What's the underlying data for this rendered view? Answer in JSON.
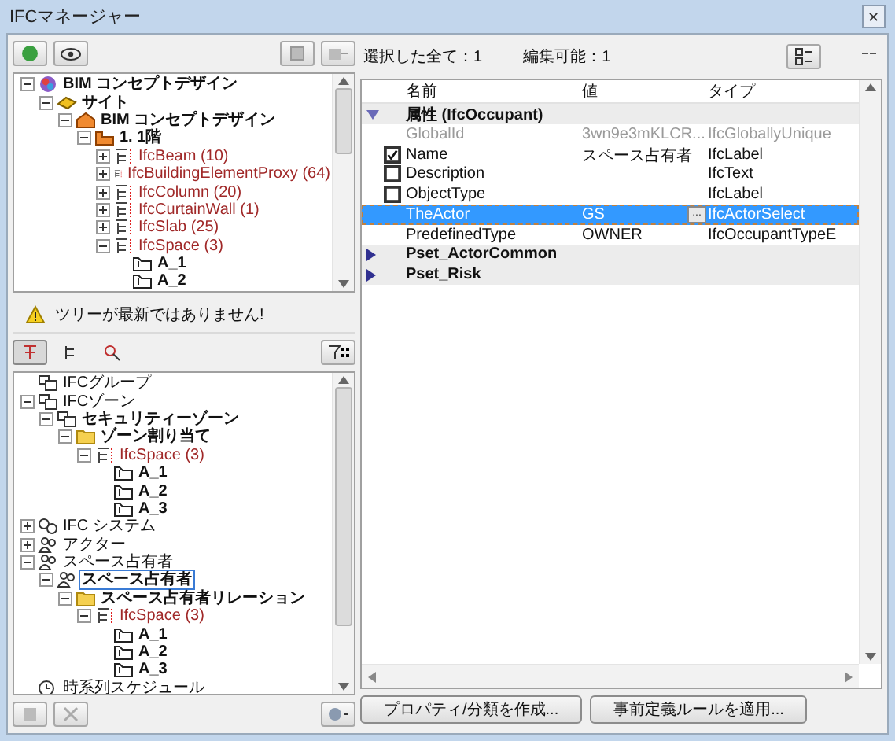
{
  "window": {
    "title": "IFCマネージャー",
    "close": "✕"
  },
  "tree_top": {
    "nodes": [
      {
        "label": "BIM コンセプトデザイン",
        "kind": "project",
        "bold": true,
        "expanded": true,
        "selected": false,
        "children": [
          {
            "label": "サイト",
            "kind": "site",
            "bold": true,
            "expanded": true,
            "selected": false,
            "children": [
              {
                "label": "BIM コンセプトデザイン",
                "kind": "building",
                "bold": true,
                "expanded": true,
                "selected": false,
                "children": [
                  {
                    "label": "1. 1階",
                    "kind": "storey",
                    "bold": true,
                    "expanded": true,
                    "selected": false,
                    "children": [
                      {
                        "label": "IfcBeam (10)",
                        "kind": "class",
                        "bold": false,
                        "expanded": false,
                        "selected": false
                      },
                      {
                        "label": "IfcBuildingElementProxy (64)",
                        "kind": "class",
                        "bold": false,
                        "expanded": false,
                        "selected": false
                      },
                      {
                        "label": "IfcColumn (20)",
                        "kind": "class",
                        "bold": false,
                        "expanded": false,
                        "selected": false
                      },
                      {
                        "label": "IfcCurtainWall (1)",
                        "kind": "class",
                        "bold": false,
                        "expanded": false,
                        "selected": false
                      },
                      {
                        "label": "IfcSlab (25)",
                        "kind": "class",
                        "bold": false,
                        "expanded": false,
                        "selected": false
                      },
                      {
                        "label": "IfcSpace (3)",
                        "kind": "class",
                        "bold": false,
                        "expanded": true,
                        "selected": false,
                        "children": [
                          {
                            "label": "A_1",
                            "kind": "space",
                            "bold": true,
                            "selected": false
                          },
                          {
                            "label": "A_2",
                            "kind": "space",
                            "bold": true,
                            "selected": false
                          }
                        ]
                      }
                    ]
                  }
                ]
              }
            ]
          }
        ]
      }
    ]
  },
  "warning": "ツリーが最新ではありません!",
  "tree_bottom": {
    "nodes": [
      {
        "label": "IFCグループ",
        "kind": "group",
        "bold": false,
        "selected": false
      },
      {
        "label": "IFCゾーン",
        "kind": "group",
        "bold": false,
        "expanded": true,
        "selected": false,
        "children": [
          {
            "label": "セキュリティーゾーン",
            "kind": "group",
            "bold": true,
            "expanded": true,
            "selected": false,
            "children": [
              {
                "label": "ゾーン割り当て",
                "kind": "folder",
                "bold": true,
                "expanded": true,
                "selected": false,
                "children": [
                  {
                    "label": "IfcSpace (3)",
                    "kind": "class",
                    "bold": false,
                    "expanded": true,
                    "selected": false,
                    "children": [
                      {
                        "label": "A_1",
                        "kind": "space",
                        "bold": true,
                        "selected": false
                      },
                      {
                        "label": "A_2",
                        "kind": "space",
                        "bold": true,
                        "selected": false
                      },
                      {
                        "label": "A_3",
                        "kind": "space",
                        "bold": true,
                        "selected": false
                      }
                    ]
                  }
                ]
              }
            ]
          }
        ]
      },
      {
        "label": "IFC システム",
        "kind": "system",
        "bold": false,
        "expanded": false,
        "selected": false
      },
      {
        "label": "アクター",
        "kind": "actor",
        "bold": false,
        "expanded": false,
        "selected": false
      },
      {
        "label": "スペース占有者",
        "kind": "actor",
        "bold": false,
        "expanded": true,
        "selected": false,
        "children": [
          {
            "label": "スペース占有者",
            "kind": "actor",
            "bold": true,
            "expanded": true,
            "selected": true,
            "children": [
              {
                "label": "スペース占有者リレーション",
                "kind": "folder",
                "bold": true,
                "expanded": true,
                "selected": false,
                "children": [
                  {
                    "label": "IfcSpace (3)",
                    "kind": "class",
                    "bold": false,
                    "expanded": true,
                    "selected": false,
                    "children": [
                      {
                        "label": "A_1",
                        "kind": "space",
                        "bold": true,
                        "selected": false
                      },
                      {
                        "label": "A_2",
                        "kind": "space",
                        "bold": true,
                        "selected": false
                      },
                      {
                        "label": "A_3",
                        "kind": "space",
                        "bold": true,
                        "selected": false
                      }
                    ]
                  }
                ]
              }
            ]
          }
        ]
      },
      {
        "label": "時系列スケジュール",
        "kind": "schedule",
        "bold": false,
        "selected": false
      }
    ]
  },
  "properties": {
    "selected_count": "選択した全て：1",
    "editable_count": "編集可能：1",
    "columns": [
      "名前",
      "値",
      "タイプ"
    ],
    "groups": [
      {
        "name": "属性 (IfcOccupant)",
        "expanded": true,
        "rows": [
          {
            "name": "GlobalId",
            "value": "3wn9e3mKLCR...",
            "type": "IfcGloballyUnique",
            "disabled": true,
            "selected": false
          },
          {
            "name": "Name",
            "value": "スペース占有者",
            "type": "IfcLabel",
            "checked": true,
            "disabled": false,
            "selected": false
          },
          {
            "name": "Description",
            "type": "IfcText",
            "checked": false,
            "disabled": false,
            "selected": false
          },
          {
            "name": "ObjectType",
            "type": "IfcLabel",
            "checked": false,
            "disabled": false,
            "selected": false
          },
          {
            "name": "TheActor",
            "value": "GS",
            "type": "IfcActorSelect",
            "browse": "...",
            "disabled": false,
            "selected": true
          },
          {
            "name": "PredefinedType",
            "value": "OWNER",
            "type": "IfcOccupantTypeE",
            "disabled": false,
            "selected": false
          }
        ]
      },
      {
        "name": "Pset_ActorCommon",
        "expanded": false
      },
      {
        "name": "Pset_Risk",
        "expanded": false
      }
    ]
  },
  "buttons": [
    "プロパティ/分類を作成...",
    "事前定義ルールを適用..."
  ]
}
